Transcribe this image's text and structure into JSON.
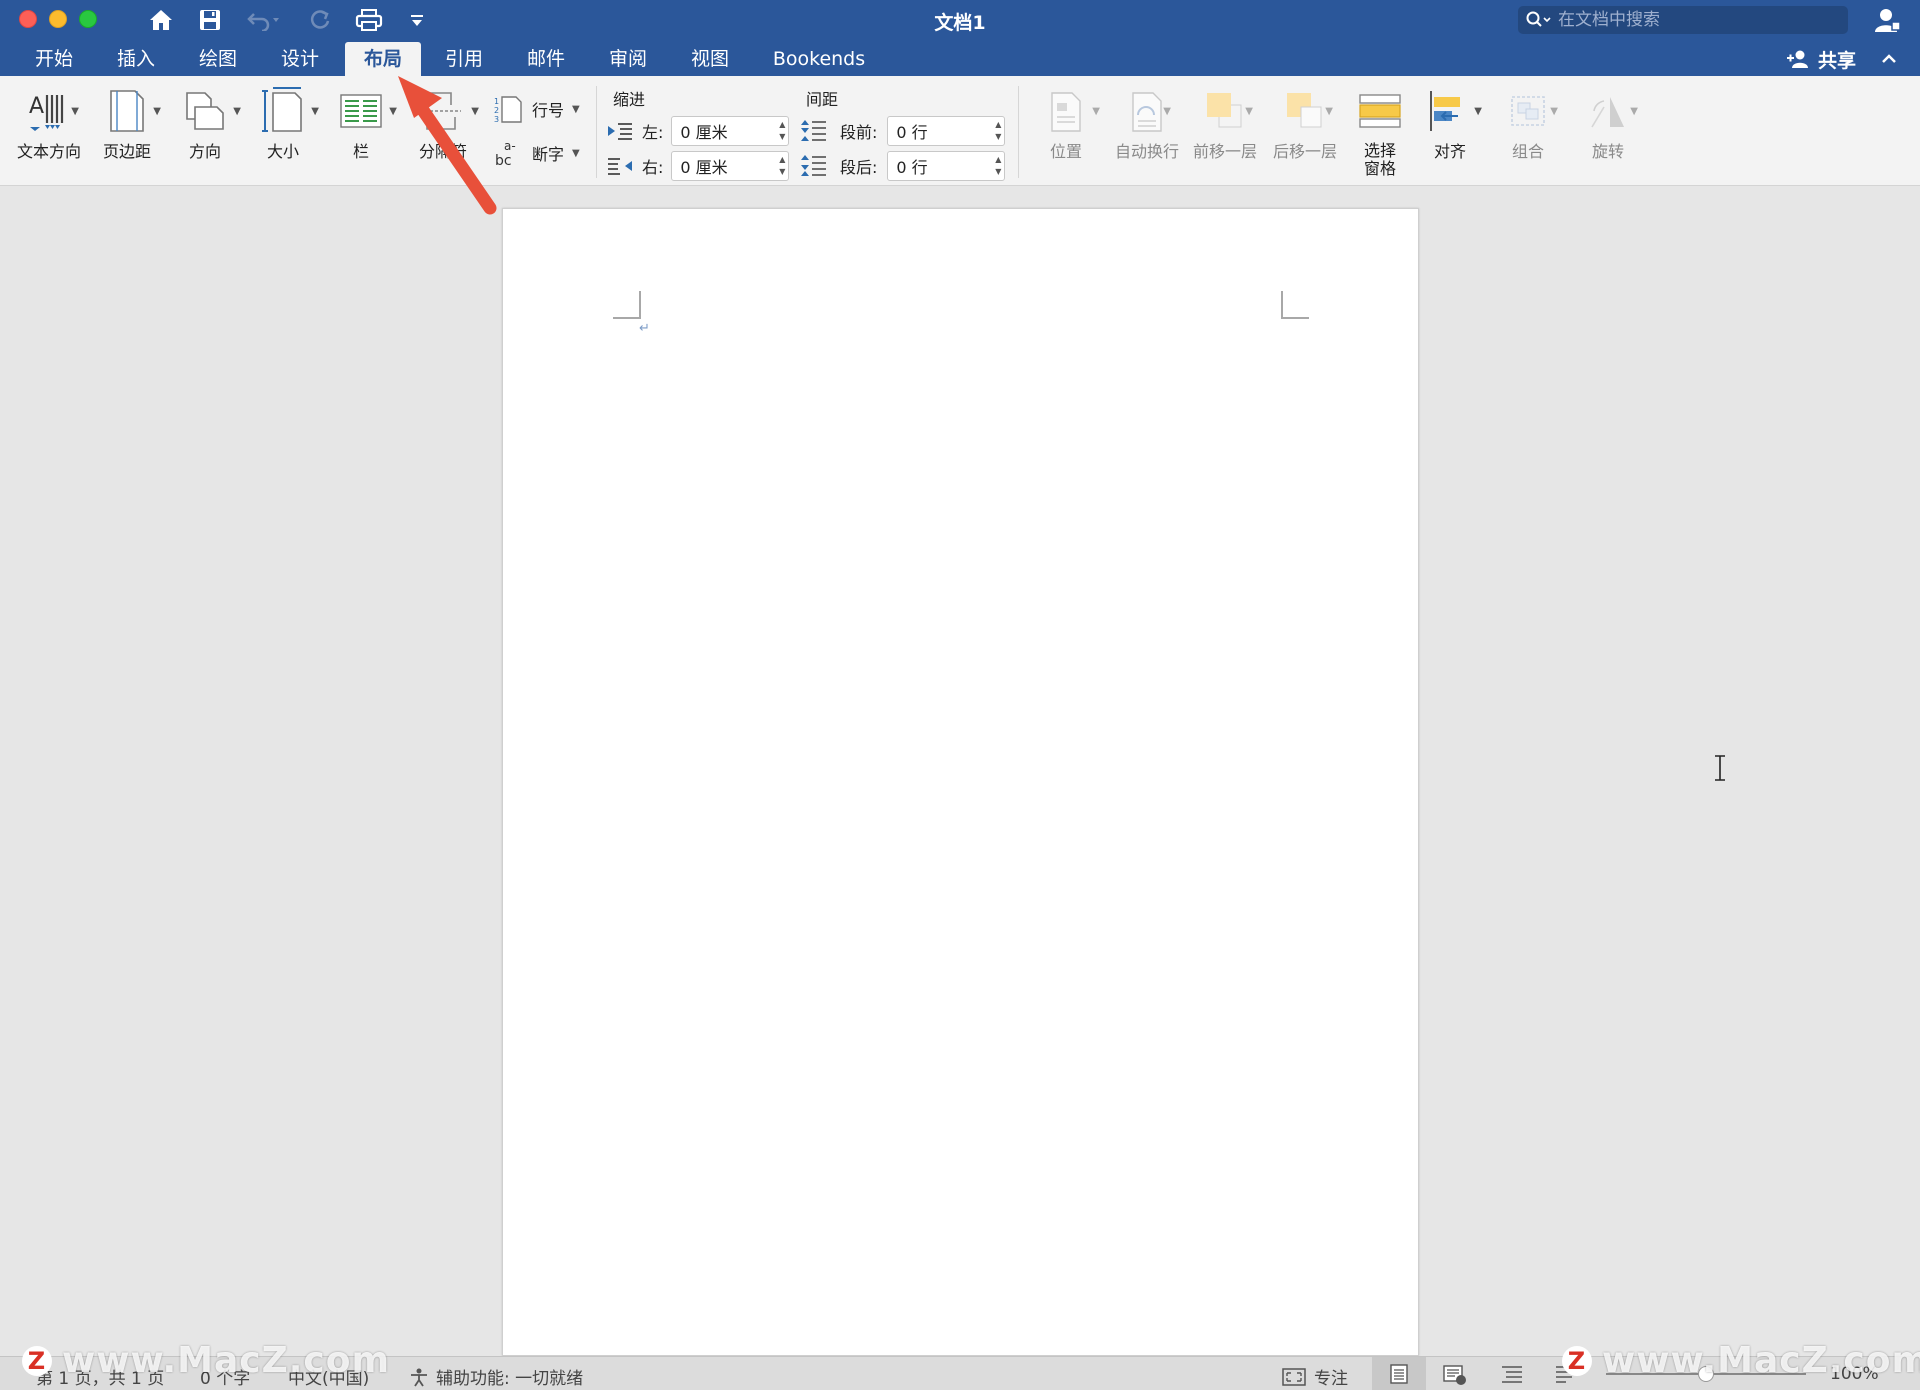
{
  "window": {
    "title": "文档1",
    "search_placeholder": "在文档中搜索"
  },
  "quick_access": {
    "icons": [
      "home-icon",
      "save-icon",
      "undo-icon",
      "redo-icon",
      "print-icon",
      "customize-icon"
    ]
  },
  "tabs": [
    {
      "label": "开始",
      "active": false
    },
    {
      "label": "插入",
      "active": false
    },
    {
      "label": "绘图",
      "active": false
    },
    {
      "label": "设计",
      "active": false
    },
    {
      "label": "布局",
      "active": true
    },
    {
      "label": "引用",
      "active": false
    },
    {
      "label": "邮件",
      "active": false
    },
    {
      "label": "审阅",
      "active": false
    },
    {
      "label": "视图",
      "active": false
    },
    {
      "label": "Bookends",
      "active": false
    }
  ],
  "share": {
    "label": "共享"
  },
  "ribbon": {
    "page_setup": {
      "text_direction": "文本方向",
      "margins": "页边距",
      "orientation": "方向",
      "size": "大小",
      "columns": "栏",
      "breaks": "分隔符",
      "line_numbers": "行号",
      "hyphenation": "断字"
    },
    "indent": {
      "label": "缩进",
      "left_label": "左:",
      "left_value": "0 厘米",
      "right_label": "右:",
      "right_value": "0 厘米"
    },
    "spacing": {
      "label": "间距",
      "before_label": "段前:",
      "before_value": "0 行",
      "after_label": "段后:",
      "after_value": "0 行"
    },
    "arrange": {
      "position": "位置",
      "wrap_text": "自动换行",
      "bring_forward": "前移一层",
      "send_backward": "后移一层",
      "selection_pane_1": "选择",
      "selection_pane_2": "窗格",
      "align": "对齐",
      "group": "组合",
      "rotate": "旋转"
    }
  },
  "statusbar": {
    "page": "第 1 页，共 1 页",
    "words": "0 个字",
    "language": "中文(中国)",
    "accessibility": "辅助功能: 一切就绪",
    "focus": "专注",
    "zoom": "100%"
  },
  "watermark": {
    "left": "www.MacZ.com",
    "right": "www.MacZ.com",
    "badge": "Z"
  },
  "colors": {
    "titlebar": "#2b579a",
    "ribbon": "#f3f3f3",
    "annotation_arrow": "#e8503a"
  }
}
